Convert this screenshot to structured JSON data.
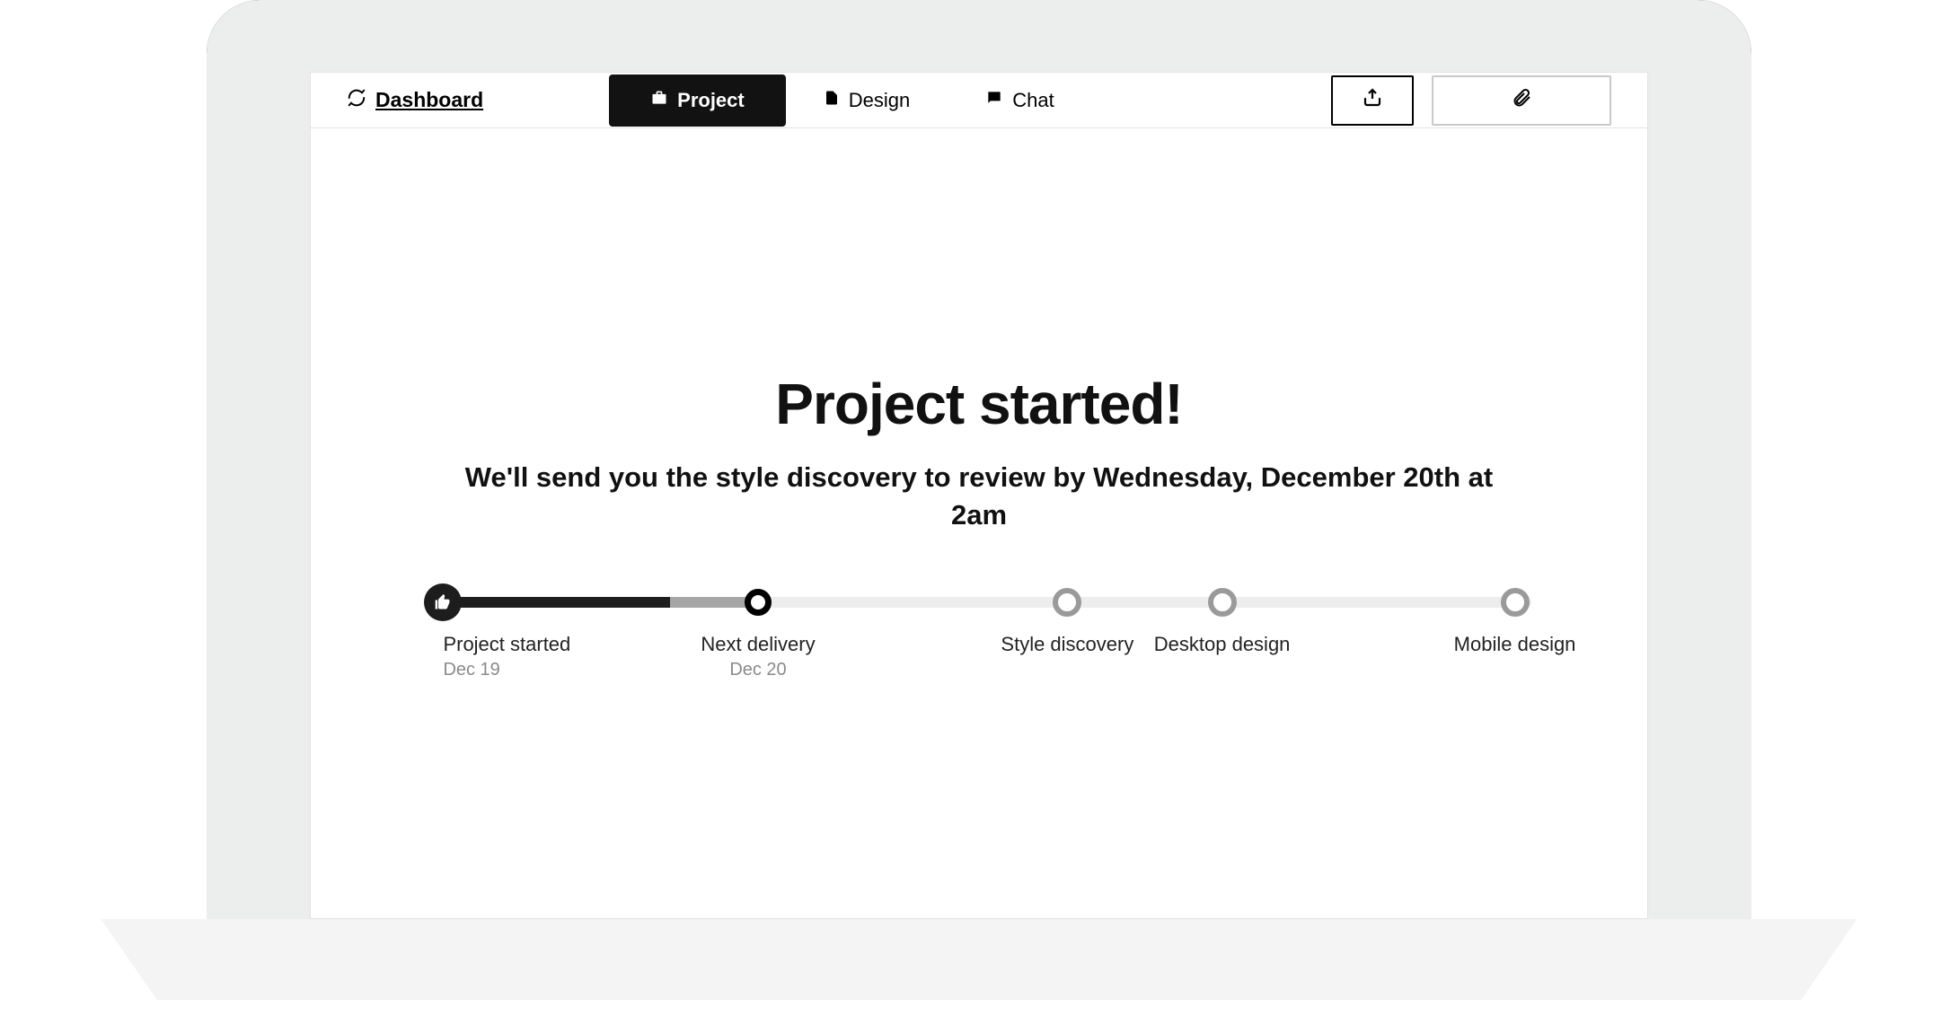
{
  "nav": {
    "dashboard": "Dashboard",
    "tabs": [
      {
        "label": "Project",
        "active": true
      },
      {
        "label": "Design",
        "active": false
      },
      {
        "label": "Chat",
        "active": false
      }
    ]
  },
  "header": {
    "title": "Project started!",
    "subtitle": "We'll send you the style discovery to review by Wednesday, December 20th at 2am"
  },
  "timeline": {
    "fill_dark_pct": 22,
    "fill_light_pct": 30,
    "steps": [
      {
        "pos": 1.5,
        "label": "Project started",
        "date": "Dec 19",
        "state": "done"
      },
      {
        "pos": 30,
        "label": "Next delivery",
        "date": "Dec 20",
        "state": "current"
      },
      {
        "pos": 58,
        "label": "Style discovery",
        "date": "",
        "state": "future"
      },
      {
        "pos": 72,
        "label": "Desktop design",
        "date": "",
        "state": "future"
      },
      {
        "pos": 98.5,
        "label": "Mobile design",
        "date": "",
        "state": "future"
      }
    ]
  }
}
